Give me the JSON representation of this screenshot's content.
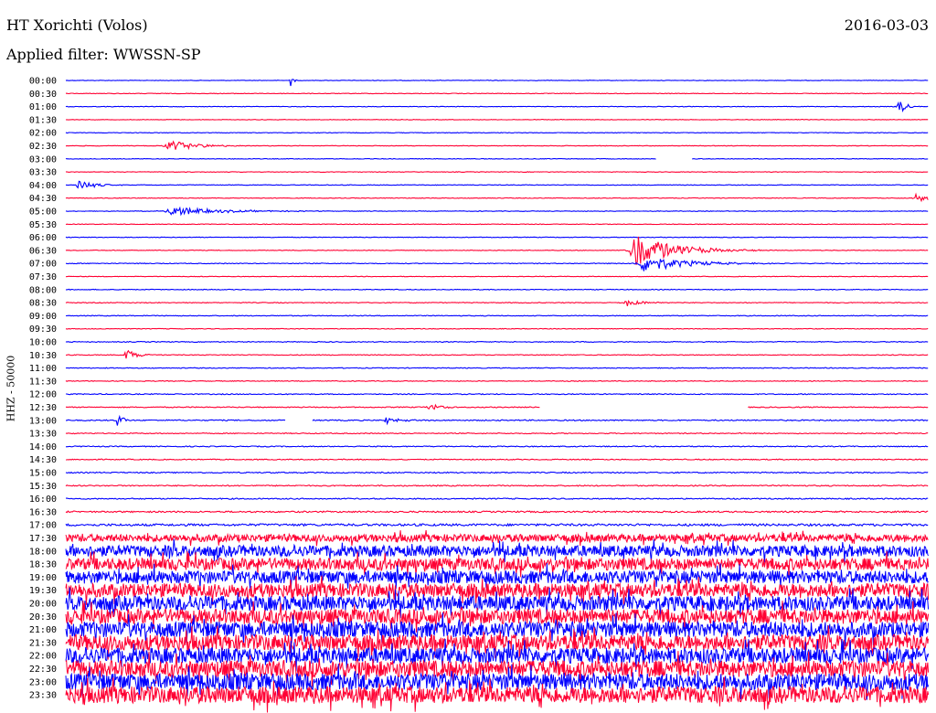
{
  "header": {
    "station": "HT Xorichti (Volos)",
    "date": "2016-03-03",
    "filter": "Applied filter: WWSSN-SP"
  },
  "axis": {
    "channel_label": "HHZ - 50000"
  },
  "colors": {
    "blue": "#0000ff",
    "red": "#ff0033"
  },
  "chart_data": {
    "type": "line",
    "title": "HT Xorichti (Volos)",
    "subtitle": "Applied filter: WWSSN-SP",
    "ylabel": "HHZ - 50000",
    "trace_labels": [
      "00:00",
      "00:30",
      "01:00",
      "01:30",
      "02:00",
      "02:30",
      "03:00",
      "03:30",
      "04:00",
      "04:30",
      "05:00",
      "05:30",
      "06:00",
      "06:30",
      "07:00",
      "07:30",
      "08:00",
      "08:30",
      "09:00",
      "09:30",
      "10:00",
      "10:30",
      "11:00",
      "11:30",
      "12:00",
      "12:30",
      "13:00",
      "13:30",
      "14:00",
      "14:30",
      "15:00",
      "15:30",
      "16:00",
      "16:30",
      "17:00",
      "17:30",
      "18:00",
      "18:30",
      "19:00",
      "19:30",
      "20:00",
      "20:30",
      "21:00",
      "21:30",
      "22:00",
      "22:30",
      "23:00",
      "23:30"
    ],
    "trace_colors": [
      "blue",
      "red"
    ],
    "noise_level": [
      0.3,
      0.3,
      0.3,
      0.3,
      0.3,
      0.3,
      0.3,
      0.3,
      0.35,
      0.35,
      0.35,
      0.3,
      0.35,
      0.35,
      0.4,
      0.3,
      0.4,
      0.4,
      0.4,
      0.35,
      0.45,
      0.4,
      0.4,
      0.4,
      0.5,
      0.5,
      0.6,
      0.5,
      0.5,
      0.5,
      0.6,
      0.6,
      0.6,
      0.8,
      1.2,
      4,
      6,
      6.5,
      7,
      7.5,
      8,
      8,
      8.5,
      8.5,
      8.5,
      9,
      9,
      9
    ],
    "events": [
      {
        "trace": 0,
        "time": 0.26,
        "amp": 8,
        "width": 0.004
      },
      {
        "trace": 2,
        "time": 0.965,
        "amp": 9,
        "width": 0.01
      },
      {
        "trace": 5,
        "time": 0.12,
        "amp": 6,
        "width": 0.035
      },
      {
        "trace": 8,
        "time": 0.015,
        "amp": 6,
        "width": 0.02
      },
      {
        "trace": 9,
        "time": 0.985,
        "amp": 5,
        "width": 0.02
      },
      {
        "trace": 10,
        "time": 0.12,
        "amp": 5,
        "width": 0.06
      },
      {
        "trace": 13,
        "time": 0.66,
        "amp": 18,
        "width": 0.05
      },
      {
        "trace": 14,
        "time": 0.67,
        "amp": 10,
        "width": 0.05
      },
      {
        "trace": 17,
        "time": 0.65,
        "amp": 4,
        "width": 0.02
      },
      {
        "trace": 21,
        "time": 0.07,
        "amp": 6,
        "width": 0.015
      },
      {
        "trace": 25,
        "time": 0.42,
        "amp": 5,
        "width": 0.015
      },
      {
        "trace": 26,
        "time": 0.06,
        "amp": 10,
        "width": 0.006
      },
      {
        "trace": 26,
        "time": 0.37,
        "amp": 5,
        "width": 0.015
      }
    ],
    "gaps": [
      {
        "trace": 6,
        "start": 0.685,
        "end": 0.725
      },
      {
        "trace": 25,
        "start": 0.55,
        "end": 0.79
      },
      {
        "trace": 26,
        "start": 0.255,
        "end": 0.285
      }
    ],
    "grid": false
  }
}
